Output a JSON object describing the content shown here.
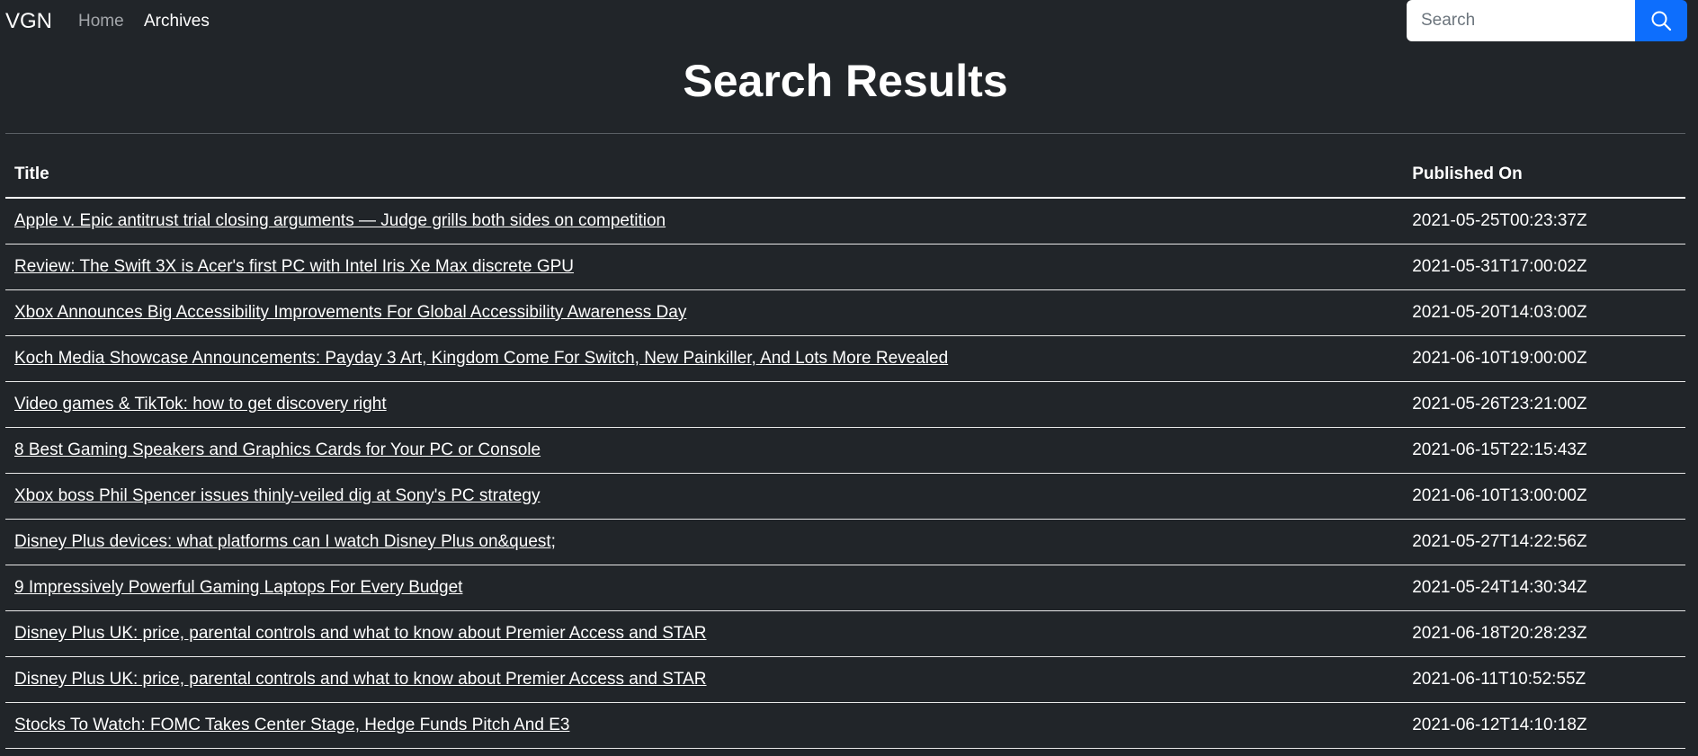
{
  "navbar": {
    "brand": "VGN",
    "links": {
      "home": "Home",
      "archives": "Archives"
    },
    "search": {
      "placeholder": "Search",
      "value": "",
      "button_icon": "search-icon",
      "button_color": "#0d6efd"
    }
  },
  "page": {
    "title": "Search Results"
  },
  "table": {
    "headers": {
      "title": "Title",
      "published": "Published On"
    },
    "rows": [
      {
        "title": "Apple v. Epic antitrust trial closing arguments — Judge grills both sides on competition",
        "published": "2021-05-25T00:23:37Z"
      },
      {
        "title": "Review: The Swift 3X is Acer's first PC with Intel Iris Xe Max discrete GPU",
        "published": "2021-05-31T17:00:02Z"
      },
      {
        "title": "Xbox Announces Big Accessibility Improvements For Global Accessibility Awareness Day",
        "published": "2021-05-20T14:03:00Z"
      },
      {
        "title": "Koch Media Showcase Announcements: Payday 3 Art, Kingdom Come For Switch, New Painkiller, And Lots More Revealed",
        "published": "2021-06-10T19:00:00Z"
      },
      {
        "title": "Video games & TikTok: how to get discovery right",
        "published": "2021-05-26T23:21:00Z"
      },
      {
        "title": "8 Best Gaming Speakers and Graphics Cards for Your PC or Console",
        "published": "2021-06-15T22:15:43Z"
      },
      {
        "title": "Xbox boss Phil Spencer issues thinly-veiled dig at Sony's PC strategy",
        "published": "2021-06-10T13:00:00Z"
      },
      {
        "title": "Disney Plus devices: what platforms can I watch Disney Plus on&quest;",
        "published": "2021-05-27T14:22:56Z"
      },
      {
        "title": "9 Impressively Powerful Gaming Laptops For Every Budget",
        "published": "2021-05-24T14:30:34Z"
      },
      {
        "title": "Disney Plus UK: price, parental controls and what to know about Premier Access and STAR",
        "published": "2021-06-18T20:28:23Z"
      },
      {
        "title": "Disney Plus UK: price, parental controls and what to know about Premier Access and STAR",
        "published": "2021-06-11T10:52:55Z"
      },
      {
        "title": "Stocks To Watch: FOMC Takes Center Stage, Hedge Funds Pitch And E3",
        "published": "2021-06-12T14:10:18Z"
      }
    ]
  },
  "colors": {
    "background": "#212529",
    "text": "#ffffff",
    "muted_nav": "#a3a6aa"
  }
}
